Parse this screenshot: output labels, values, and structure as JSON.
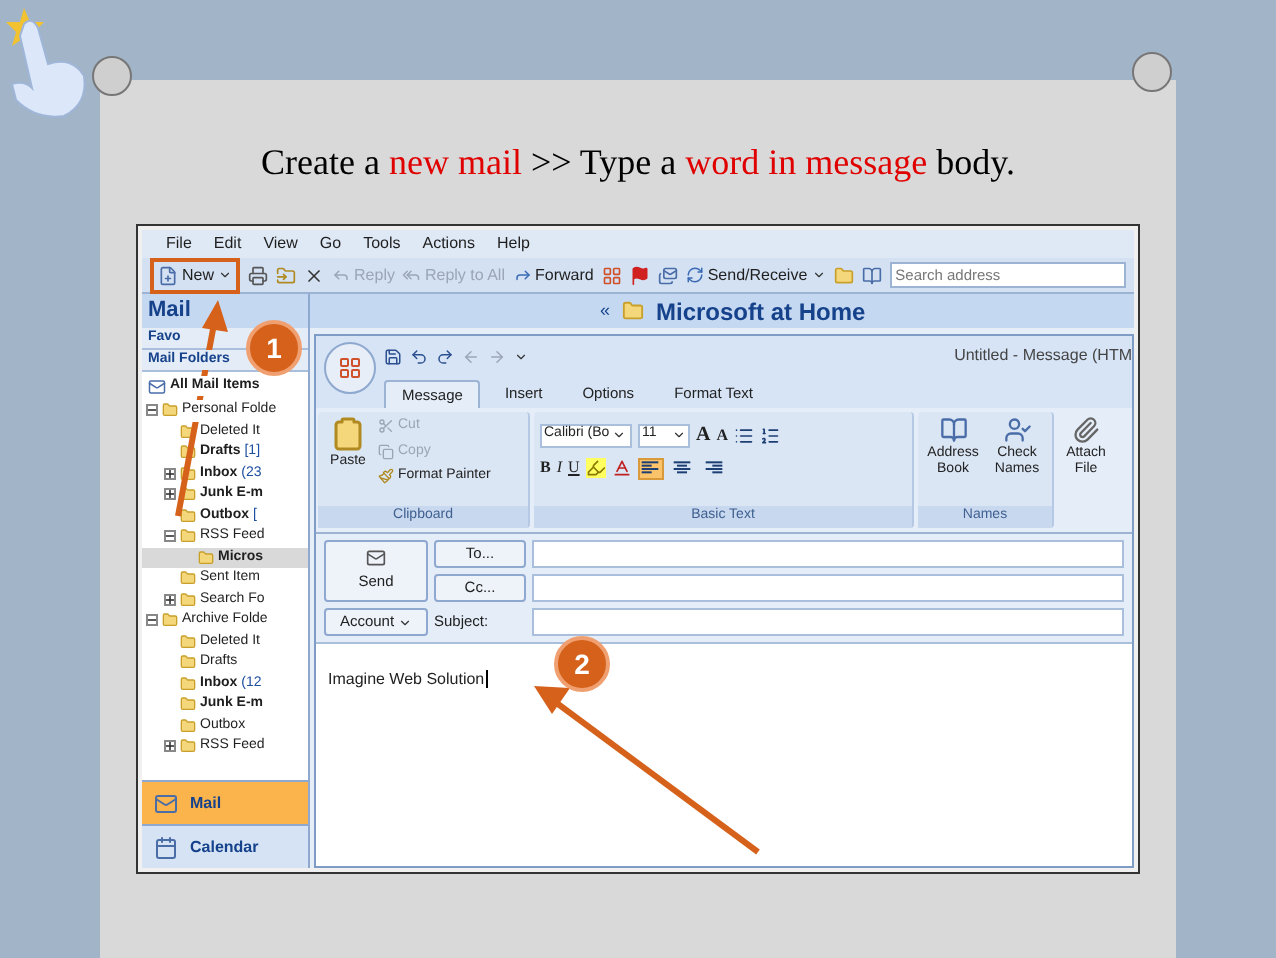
{
  "slide": {
    "title": [
      {
        "text": "Create a ",
        "highlight": false
      },
      {
        "text": "new mail",
        "highlight": true
      },
      {
        "text": " >> Type a ",
        "highlight": false
      },
      {
        "text": "word in message",
        "highlight": true
      },
      {
        "text": " body.",
        "highlight": false
      }
    ]
  },
  "menu_bar": [
    "File",
    "Edit",
    "View",
    "Go",
    "Tools",
    "Actions",
    "Help"
  ],
  "toolbar": {
    "new": "New",
    "reply": {
      "label": "Reply",
      "disabled": true
    },
    "reply_all": {
      "label": "Reply to All",
      "disabled": true
    },
    "forward": {
      "label": "Forward",
      "disabled": false
    },
    "send_receive": "Send/Receive",
    "search": {
      "placeholder": "Search address"
    }
  },
  "nav_pane": {
    "title": "Mail",
    "favorites": "Favo",
    "mail_folders": "Mail Folders",
    "all_items": "All Mail Items",
    "folders": [
      {
        "label": "Personal Folde",
        "expanded": true,
        "selected": false,
        "unread": false,
        "children": [
          {
            "label": "Deleted It",
            "selected": false,
            "unread": false
          },
          {
            "label": "Drafts",
            "count": "[1]",
            "selected": false,
            "unread": true
          },
          {
            "label": "Inbox",
            "count": "(23",
            "expanded": false,
            "selected": false,
            "unread": true
          },
          {
            "label": "Junk E-m",
            "expanded": false,
            "selected": false,
            "unread": true
          },
          {
            "label": "Outbox",
            "count": "[",
            "selected": false,
            "unread": true
          },
          {
            "label": "RSS Feed",
            "expanded": true,
            "selected": false,
            "unread": false,
            "children": [
              {
                "label": "Micros",
                "selected": true,
                "unread": true
              }
            ]
          },
          {
            "label": "Sent Item",
            "selected": false,
            "unread": false
          },
          {
            "label": "Search Fo",
            "expanded": false,
            "selected": false,
            "unread": false
          }
        ]
      },
      {
        "label": "Archive Folde",
        "expanded": true,
        "selected": false,
        "unread": false,
        "children": [
          {
            "label": "Deleted It",
            "selected": false,
            "unread": false
          },
          {
            "label": "Drafts",
            "selected": false,
            "unread": false
          },
          {
            "label": "Inbox",
            "count": "(12",
            "selected": false,
            "unread": true
          },
          {
            "label": "Junk E-m",
            "selected": false,
            "unread": true
          },
          {
            "label": "Outbox",
            "selected": false,
            "unread": false
          },
          {
            "label": "RSS Feed",
            "expanded": false,
            "selected": false,
            "unread": false
          }
        ]
      }
    ],
    "buttons": [
      {
        "label": "Mail",
        "selected": true
      },
      {
        "label": "Calendar",
        "selected": false
      }
    ]
  },
  "reading_pane": {
    "collapse": "«",
    "title": "Microsoft at Home"
  },
  "compose": {
    "title": "Untitled - Message (HTM",
    "tabs": [
      {
        "label": "Message",
        "selected": true
      },
      {
        "label": "Insert",
        "selected": false
      },
      {
        "label": "Options",
        "selected": false
      },
      {
        "label": "Format Text",
        "selected": false
      }
    ],
    "clipboard": {
      "paste": "Paste",
      "cut": {
        "label": "Cut",
        "disabled": true
      },
      "copy": {
        "label": "Copy",
        "disabled": true
      },
      "format_painter": "Format Painter",
      "group": "Clipboard"
    },
    "basic_text": {
      "font": "Calibri (Bo",
      "size": "11",
      "grow": "A",
      "shrink": "A",
      "bold": "B",
      "italic": "I",
      "underline": "U",
      "alignment": [
        {
          "selected": true
        },
        {
          "selected": false
        },
        {
          "selected": false
        }
      ],
      "group": "Basic Text"
    },
    "names": {
      "address_book": "Address Book",
      "check_names": "Check Names",
      "group": "Names"
    },
    "attach": "Attach File",
    "send": "Send",
    "to": "To...",
    "cc": "Cc...",
    "account": "Account",
    "subject": "Subject:",
    "body": "Imagine Web Solution"
  },
  "annotations": [
    {
      "number": "1"
    },
    {
      "number": "2"
    }
  ]
}
